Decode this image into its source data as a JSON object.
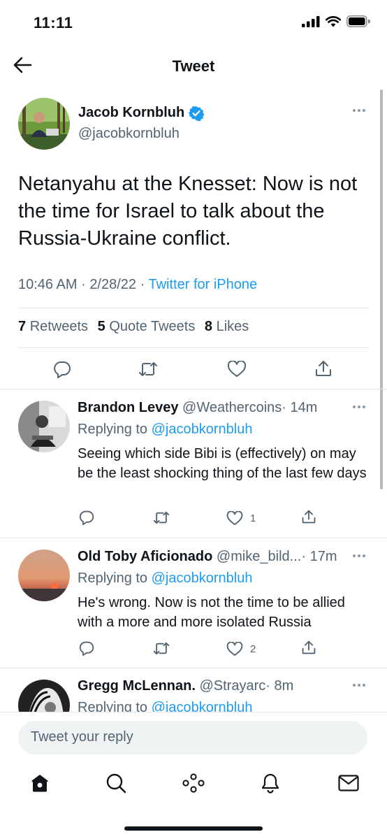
{
  "status_bar": {
    "time": "11:11"
  },
  "header": {
    "title": "Tweet"
  },
  "main_tweet": {
    "name": "Jacob Kornbluh",
    "handle": "@jacobkornbluh",
    "text": "Netanyahu at the Knesset: Now is not the time for Israel to talk about the Russia-Ukraine conflict.",
    "time": "10:46 AM",
    "date": "2/28/22",
    "source": "Twitter for iPhone",
    "separator": "·",
    "stats": {
      "retweets_count": "7",
      "retweets_label": "Retweets",
      "quotes_count": "5",
      "quotes_label": "Quote Tweets",
      "likes_count": "8",
      "likes_label": "Likes"
    }
  },
  "replies": [
    {
      "name": "Brandon Levey",
      "handle": "@Weathercoins",
      "time": "· 14m",
      "replying_prefix": "Replying to",
      "replying_to": "@jacobkornbluh",
      "text": "Seeing which side Bibi is (effectively) on may be the least shocking thing of the last few days",
      "likes": "1"
    },
    {
      "name": "Old Toby Aficionado",
      "handle": "@mike_bild...",
      "time": "· 17m",
      "replying_prefix": "Replying to",
      "replying_to": "@jacobkornbluh",
      "text": "He's wrong. Now is not the time to be allied with a more and more isolated Russia",
      "likes": "2"
    },
    {
      "name": "Gregg McLennan.",
      "handle": "@Strayarc",
      "time": "· 8m",
      "replying_prefix": "Replying to",
      "replying_to": "@jacobkornbluh"
    }
  ],
  "composer": {
    "placeholder": "Tweet your reply"
  },
  "bottom_nav": [
    "home-icon",
    "search-icon",
    "spaces-icon",
    "notifications-icon",
    "messages-icon"
  ],
  "colors": {
    "accent": "#1d9bf0",
    "text": "#0f1419",
    "secondary": "#536471"
  }
}
